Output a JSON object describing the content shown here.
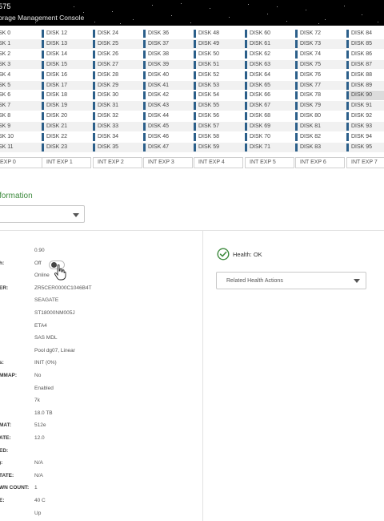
{
  "header": {
    "model": "575",
    "product": "orage Management Console"
  },
  "disk_grid": {
    "rows": [
      [
        "SK 0",
        "DISK 12",
        "DISK 24",
        "DISK 36",
        "DISK 48",
        "DISK 60",
        "DISK 72",
        "DISK 84"
      ],
      [
        "SK 1",
        "DISK 13",
        "DISK 25",
        "DISK 37",
        "DISK 49",
        "DISK 61",
        "DISK 73",
        "DISK 85"
      ],
      [
        "SK 2",
        "DISK 14",
        "DISK 26",
        "DISK 38",
        "DISK 50",
        "DISK 62",
        "DISK 74",
        "DISK 86"
      ],
      [
        "SK 3",
        "DISK 15",
        "DISK 27",
        "DISK 39",
        "DISK 51",
        "DISK 63",
        "DISK 75",
        "DISK 87"
      ],
      [
        "SK 4",
        "DISK 16",
        "DISK 28",
        "DISK 40",
        "DISK 52",
        "DISK 64",
        "DISK 76",
        "DISK 88"
      ],
      [
        "SK 5",
        "DISK 17",
        "DISK 29",
        "DISK 41",
        "DISK 53",
        "DISK 65",
        "DISK 77",
        "DISK 89"
      ],
      [
        "SK 6",
        "DISK 18",
        "DISK 30",
        "DISK 42",
        "DISK 54",
        "DISK 66",
        "DISK 78",
        "DISK 90"
      ],
      [
        "SK 7",
        "DISK 19",
        "DISK 31",
        "DISK 43",
        "DISK 55",
        "DISK 67",
        "DISK 79",
        "DISK 91"
      ],
      [
        "SK 8",
        "DISK 20",
        "DISK 32",
        "DISK 44",
        "DISK 56",
        "DISK 68",
        "DISK 80",
        "DISK 92"
      ],
      [
        "SK 9",
        "DISK 21",
        "DISK 33",
        "DISK 45",
        "DISK 57",
        "DISK 69",
        "DISK 81",
        "DISK 93"
      ],
      [
        "SK 10",
        "DISK 22",
        "DISK 34",
        "DISK 46",
        "DISK 58",
        "DISK 70",
        "DISK 82",
        "DISK 94"
      ],
      [
        "SK 11",
        "DISK 23",
        "DISK 35",
        "DISK 47",
        "DISK 59",
        "DISK 71",
        "DISK 83",
        "DISK 95"
      ]
    ],
    "selected": "DISK 90",
    "expanders": [
      "EXP 0",
      "INT EXP 1",
      "INT EXP 2",
      "INT EXP 3",
      "INT EXP 4",
      "INT EXP 5",
      "INT EXP 6",
      "INT EXP 7"
    ]
  },
  "info_section": {
    "title": "formation",
    "select_value": ""
  },
  "properties": [
    {
      "label": "",
      "value": "0.90"
    },
    {
      "label": "h:",
      "value": "Off"
    },
    {
      "label": "",
      "value": "Online"
    },
    {
      "label": "ER:",
      "value": "ZR5CER0000C1046B4T"
    },
    {
      "label": "",
      "value": "SEAGATE"
    },
    {
      "label": "",
      "value": "ST18000NM005J"
    },
    {
      "label": "",
      "value": "ETA4"
    },
    {
      "label": "",
      "value": "SAS MDL"
    },
    {
      "label": "",
      "value": "Pool dg07, Linear"
    },
    {
      "label": "s:",
      "value": "INIT (0%)"
    },
    {
      "label": "MMAP:",
      "value": "No"
    },
    {
      "label": "",
      "value": "Enabled"
    },
    {
      "label": "",
      "value": "7k"
    },
    {
      "label": "",
      "value": "18.0 TB"
    },
    {
      "label": "MAT:",
      "value": "512e"
    },
    {
      "label": "ATE:",
      "value": "12.0"
    },
    {
      "label": "ED:",
      "value": ""
    },
    {
      "label": "):",
      "value": "N/A"
    },
    {
      "label": "TATE:",
      "value": "N/A"
    },
    {
      "label": "WN COUNT:",
      "value": "1"
    },
    {
      "label": "E:",
      "value": "40 C"
    },
    {
      "label": "",
      "value": "Up"
    }
  ],
  "toggle": {
    "on": false
  },
  "health": {
    "status_text": "Health: OK",
    "actions_label": "Related Health Actions"
  },
  "colors": {
    "header_bg": "#000000",
    "section_title": "#3d8a3d",
    "disk_marker": "#2b5f8a",
    "health_ok": "#3d8a3d"
  }
}
